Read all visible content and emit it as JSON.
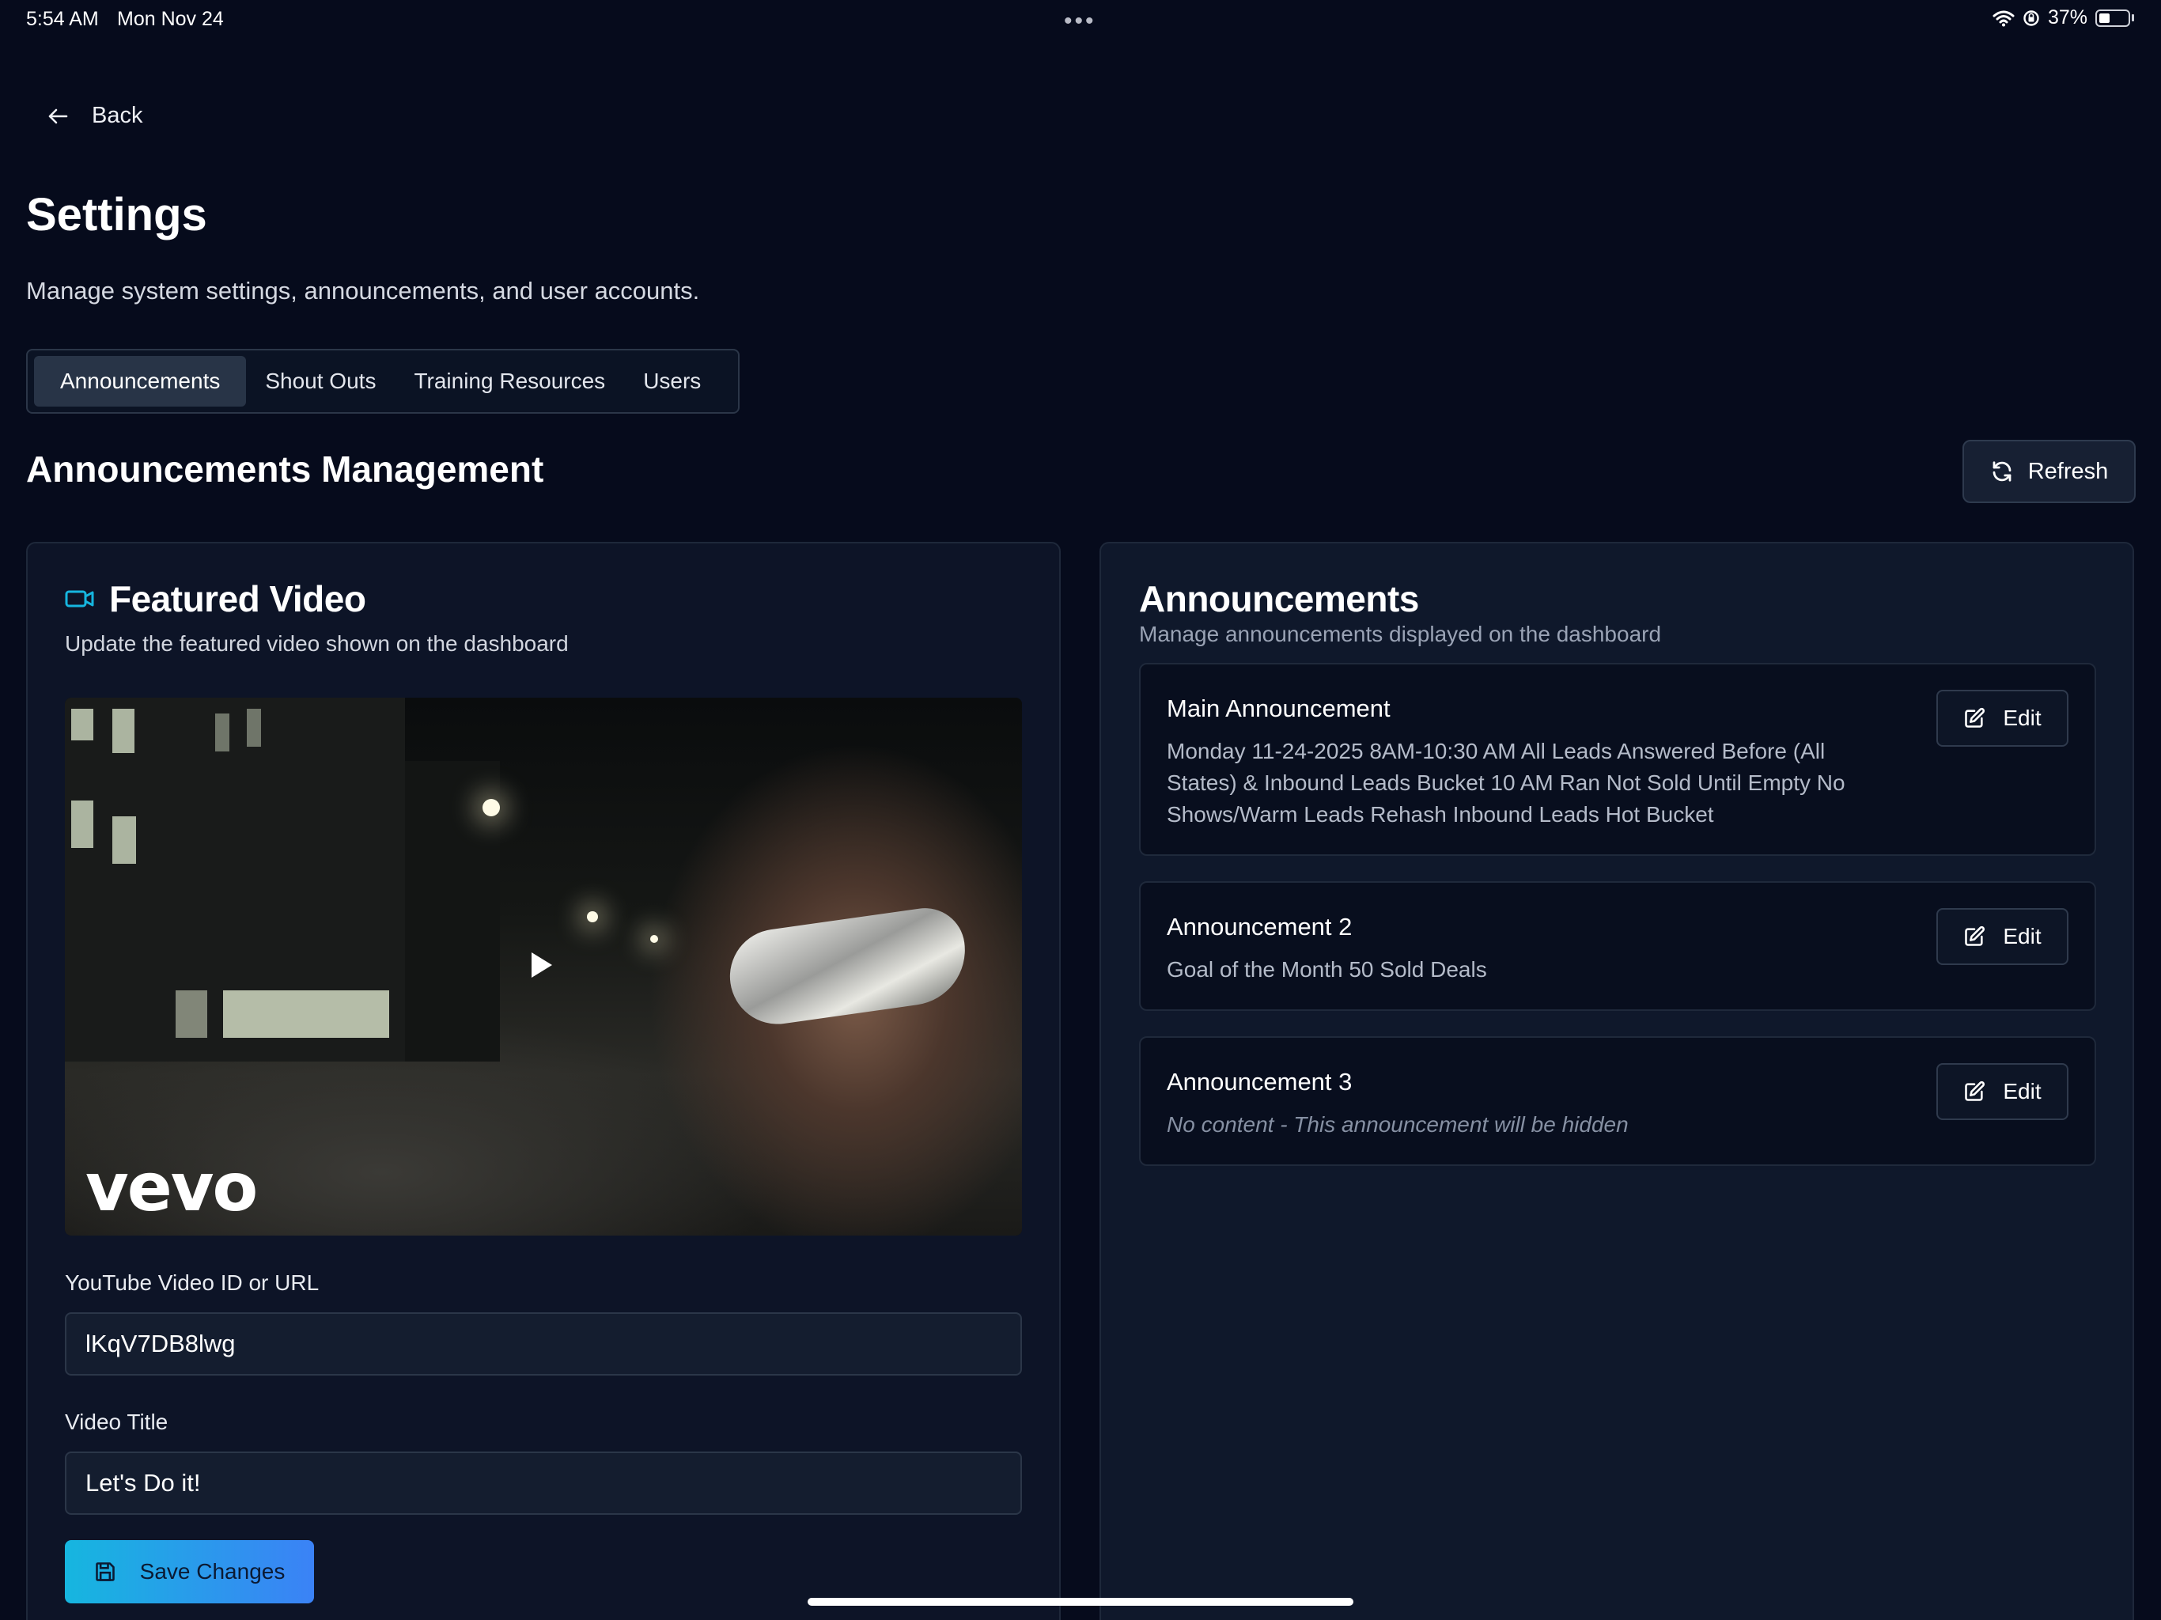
{
  "status_bar": {
    "time": "5:54 AM",
    "date": "Mon Nov 24",
    "dots": "•••",
    "battery_text": "37%",
    "battery_level": 0.37
  },
  "nav": {
    "back_label": "Back"
  },
  "page": {
    "title": "Settings",
    "subtitle": "Manage system settings, announcements, and user accounts."
  },
  "tabs": [
    {
      "label": "Announcements",
      "active": true
    },
    {
      "label": "Shout Outs",
      "active": false
    },
    {
      "label": "Training Resources",
      "active": false
    },
    {
      "label": "Users",
      "active": false
    }
  ],
  "section": {
    "title": "Announcements Management",
    "refresh_label": "Refresh"
  },
  "featured_video": {
    "title": "Featured Video",
    "description": "Update the featured video shown on the dashboard",
    "video_watermark": "vevo",
    "url_label": "YouTube Video ID or URL",
    "url_value": "lKqV7DB8lwg",
    "title_label": "Video Title",
    "title_value": "Let's Do it!",
    "save_label": "Save Changes"
  },
  "announcements": {
    "title": "Announcements",
    "description": "Manage announcements displayed on the dashboard",
    "edit_label": "Edit",
    "items": [
      {
        "name": "Main Announcement",
        "body": "Monday 11-24-2025 8AM-10:30 AM All Leads Answered Before (All States) & Inbound Leads Bucket 10 AM Ran Not Sold Until Empty No Shows/Warm Leads Rehash Inbound Leads Hot Bucket"
      },
      {
        "name": "Announcement 2",
        "body": "Goal of the Month 50 Sold Deals"
      },
      {
        "name": "Announcement 3",
        "body": "No content - This announcement will be hidden"
      }
    ]
  },
  "colors": {
    "background": "#060b1c",
    "accent_cyan": "#16b6df",
    "accent_blue": "#3b82f6"
  },
  "icons": {
    "back": "arrow-left-icon",
    "refresh": "refresh-icon",
    "video": "video-camera-icon",
    "save": "floppy-disk-icon",
    "edit": "edit-square-icon",
    "play": "play-icon",
    "wifi": "wifi-icon",
    "lock": "orientation-lock-icon",
    "battery": "battery-icon"
  }
}
